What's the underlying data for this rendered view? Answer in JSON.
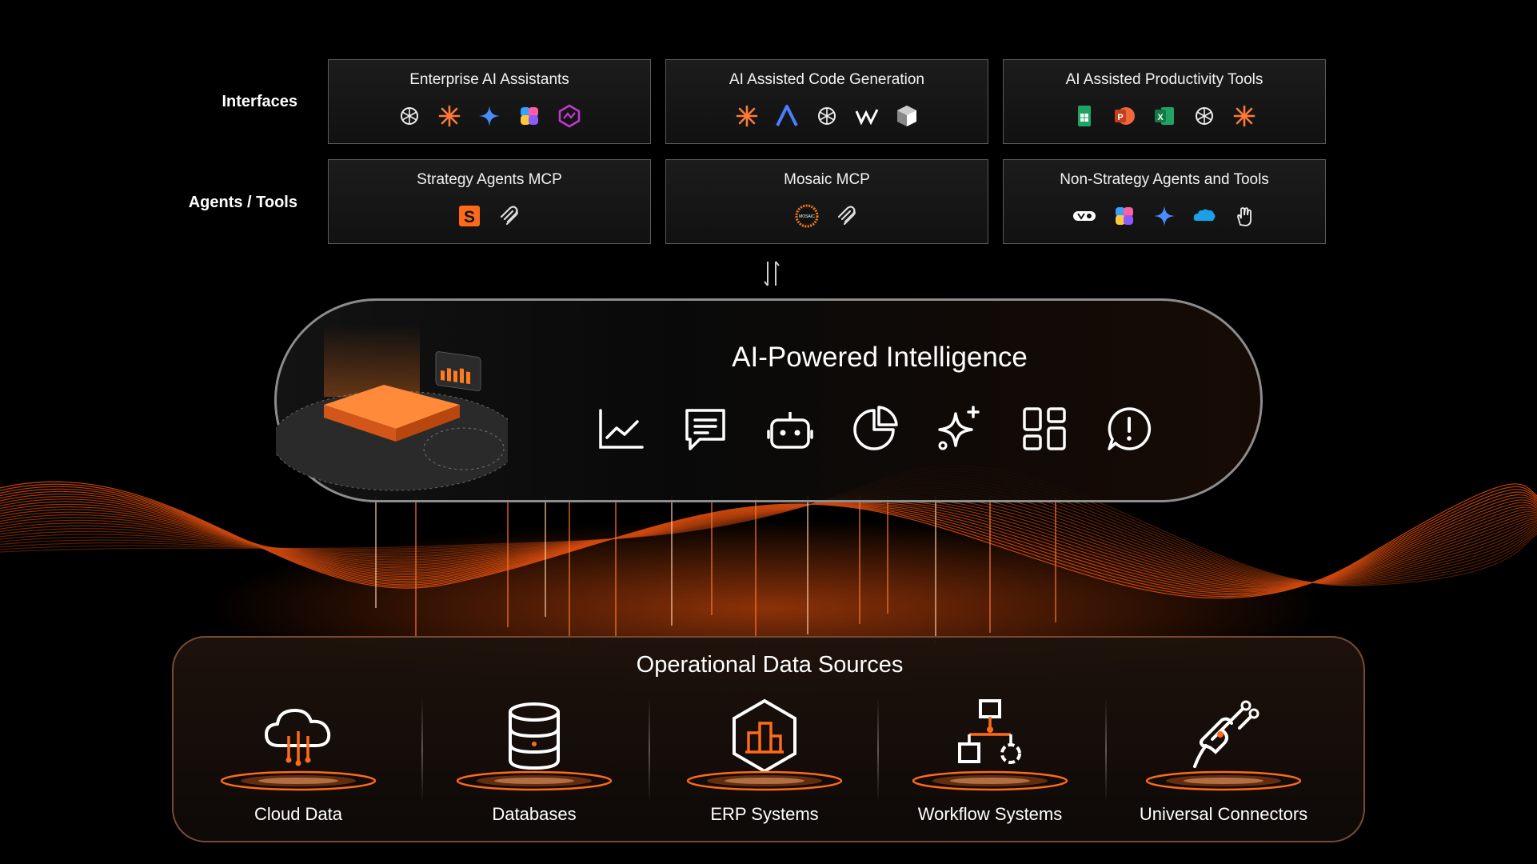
{
  "rows": {
    "interfaces_label": "Interfaces",
    "agents_label": "Agents / Tools"
  },
  "panels": [
    {
      "title": "Enterprise AI Assistants",
      "icons": [
        "openai-icon",
        "claude-icon",
        "gemini-icon",
        "copilot-icon",
        "mosaic-hexagon-icon"
      ]
    },
    {
      "title": "AI Assisted Code Generation",
      "icons": [
        "claude-icon",
        "anthropic-a-icon",
        "openai-icon",
        "windsurf-icon",
        "cube-icon"
      ]
    },
    {
      "title": "AI Assisted Productivity Tools",
      "icons": [
        "google-sheets-icon",
        "powerpoint-icon",
        "excel-icon",
        "openai-icon",
        "claude-icon"
      ]
    },
    {
      "title": "Strategy Agents MCP",
      "icons": [
        "strategy-s-icon",
        "mcp-icon"
      ]
    },
    {
      "title": "Mosaic MCP",
      "icons": [
        "mosaic-logo-icon",
        "mcp-icon"
      ]
    },
    {
      "title": "Non-Strategy Agents and Tools",
      "icons": [
        "vercel-icon",
        "copilot-icon",
        "gemini-icon",
        "salesforce-icon",
        "hand-icon"
      ]
    }
  ],
  "mosaic_logo_text": "MOSAIC",
  "ai": {
    "title": "AI-Powered Intelligence",
    "icons": [
      "line-chart-icon",
      "document-icon",
      "robot-icon",
      "pie-chart-icon",
      "sparkle-icon",
      "dashboard-icon",
      "alert-message-icon"
    ]
  },
  "ops": {
    "title": "Operational Data Sources",
    "sources": [
      {
        "label": "Cloud Data",
        "icon": "cloud-data-icon"
      },
      {
        "label": "Databases",
        "icon": "database-icon"
      },
      {
        "label": "ERP Systems",
        "icon": "erp-icon"
      },
      {
        "label": "Workflow Systems",
        "icon": "workflow-icon"
      },
      {
        "label": "Universal Connectors",
        "icon": "connector-icon"
      }
    ]
  },
  "colors": {
    "accent": "#ff6a1a",
    "panel_border": "#5a5a5a",
    "background": "#000000"
  }
}
